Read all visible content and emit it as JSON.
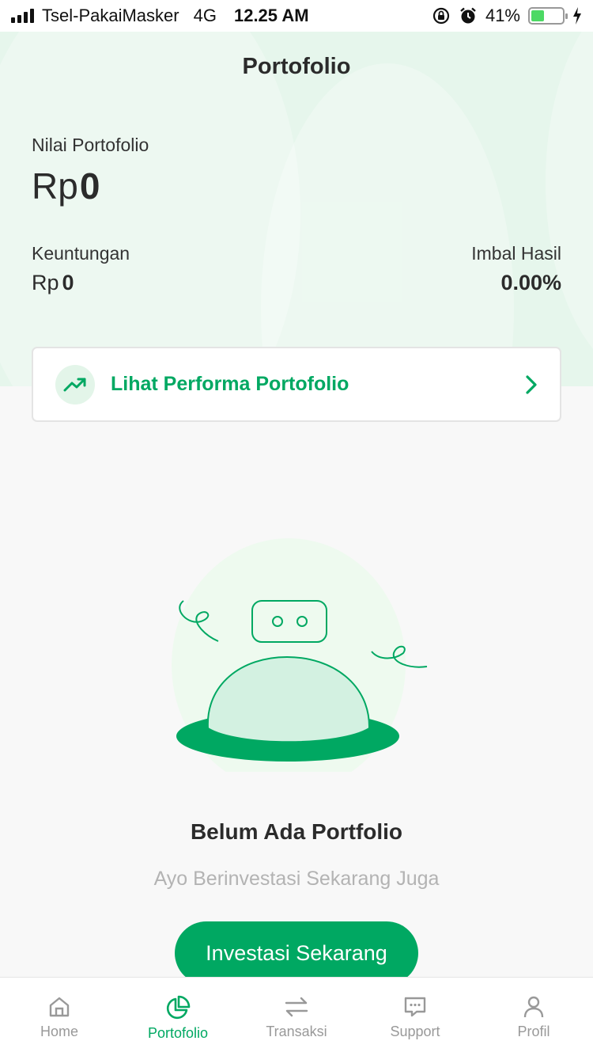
{
  "status_bar": {
    "carrier": "Tsel-PakaiMasker",
    "network": "4G",
    "time": "12.25 AM",
    "battery": "41%",
    "battery_level": 0.41
  },
  "header": {
    "title": "Portofolio"
  },
  "portfolio": {
    "value_label": "Nilai Portofolio",
    "value_currency": "Rp",
    "value_amount": "0",
    "profit_label": "Keuntungan",
    "profit_currency": "Rp",
    "profit_amount": "0",
    "return_label": "Imbal Hasil",
    "return_value": "0.00%"
  },
  "performance_card": {
    "label": "Lihat Performa Portofolio",
    "icon": "trending-up-icon"
  },
  "empty_state": {
    "title": "Belum Ada Portfolio",
    "subtitle": "Ayo Berinvestasi Sekarang Juga",
    "button_label": "Investasi Sekarang"
  },
  "tabbar": {
    "items": [
      {
        "label": "Home",
        "icon": "home-icon"
      },
      {
        "label": "Portofolio",
        "icon": "pie-chart-icon",
        "active": true
      },
      {
        "label": "Transaksi",
        "icon": "swap-icon"
      },
      {
        "label": "Support",
        "icon": "chat-icon"
      },
      {
        "label": "Profil",
        "icon": "user-icon"
      }
    ]
  },
  "colors": {
    "brand": "#00a862",
    "hero_bg": "#e6f6ec",
    "muted": "#b3b3b3"
  }
}
